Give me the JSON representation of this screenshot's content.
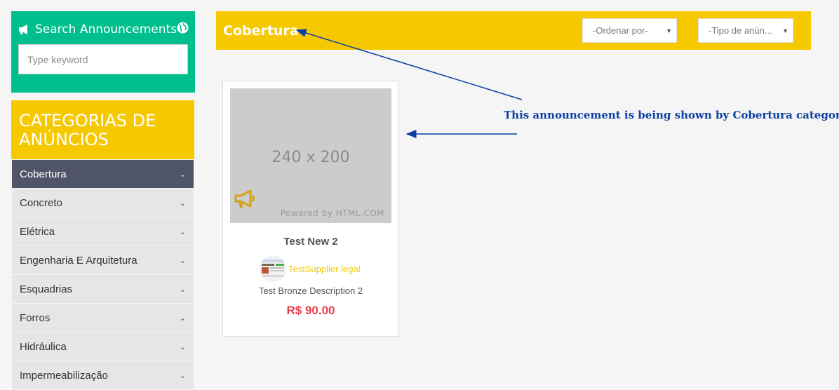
{
  "search": {
    "title": "Search Announcements",
    "placeholder": "Type keyword"
  },
  "categories": {
    "header": "CATEGORIAS DE ANÚNCIOS",
    "items": [
      {
        "label": "Cobertura",
        "active": true
      },
      {
        "label": "Concreto"
      },
      {
        "label": "Elétrica"
      },
      {
        "label": "Engenharia E Arquitetura"
      },
      {
        "label": "Esquadrias"
      },
      {
        "label": "Forros"
      },
      {
        "label": "Hidráulica"
      },
      {
        "label": "Impermeabilização"
      }
    ]
  },
  "topbar": {
    "title": "Cobertura",
    "order_select": "-Ordenar por-",
    "type_select": "-Tipo de anún..."
  },
  "card": {
    "image_size": "240 x 200",
    "image_powered": "Powered by HTML.COM",
    "title": "Test New 2",
    "supplier": "TestSupplier legal",
    "description": "Test Bronze Description 2",
    "price": "R$ 90.00"
  },
  "annotation": {
    "text": "This announcement is being shown by Cobertura category."
  },
  "colors": {
    "green": "#00bf8f",
    "yellow": "#f5c800",
    "active_category": "#4f5566",
    "price": "#e8414e",
    "annotation": "#0c3fa3"
  }
}
